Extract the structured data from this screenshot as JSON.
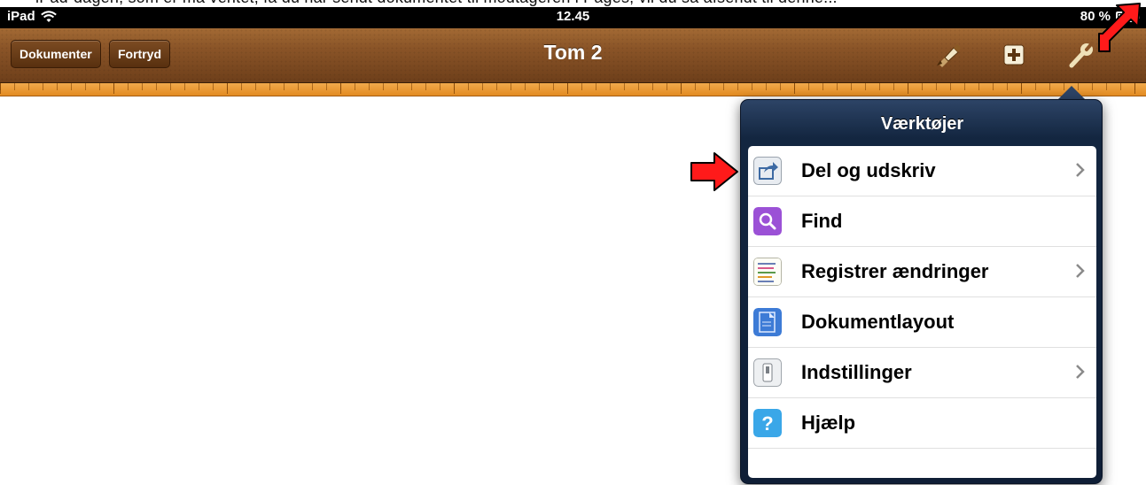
{
  "caption": {
    "text": "iPad-dagen, som er må ventet, få du har sendt dokumentet til modtageren i Pages, vil du så afsendt til denne..."
  },
  "status_bar": {
    "carrier": "iPad",
    "time": "12.45",
    "battery": "80 %"
  },
  "toolbar": {
    "documents_label": "Dokumenter",
    "undo_label": "Fortryd",
    "title": "Tom 2"
  },
  "document": {
    "partial_text": ""
  },
  "popover": {
    "title": "Værktøjer",
    "items": [
      {
        "label": "Del og udskriv",
        "icon": "share-icon",
        "has_chevron": true
      },
      {
        "label": "Find",
        "icon": "find-icon",
        "has_chevron": false
      },
      {
        "label": "Registrer ændringer",
        "icon": "track-changes-icon",
        "has_chevron": true
      },
      {
        "label": "Dokumentlayout",
        "icon": "document-layout-icon",
        "has_chevron": false
      },
      {
        "label": "Indstillinger",
        "icon": "settings-icon",
        "has_chevron": true
      },
      {
        "label": "Hjælp",
        "icon": "help-icon",
        "has_chevron": false
      }
    ]
  },
  "colors": {
    "toolbar_leather": "#8b5528",
    "ruler_orange": "#e28b22",
    "popover_navy": "#132640",
    "annotation_red": "#ff0000"
  }
}
